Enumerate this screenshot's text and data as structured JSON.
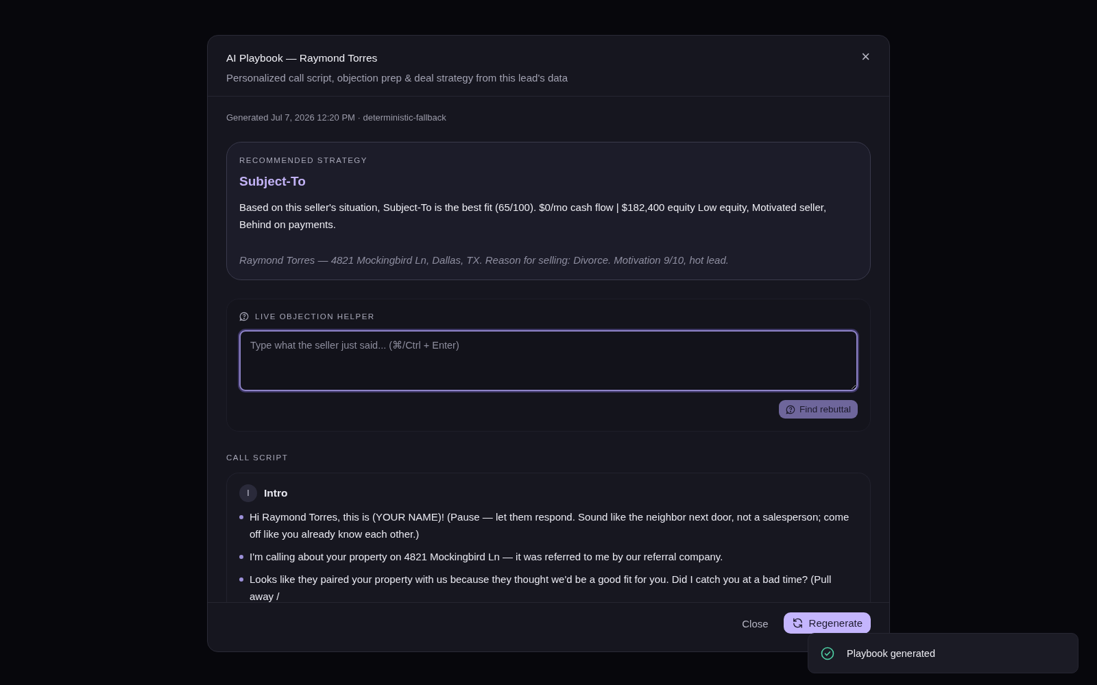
{
  "dialog": {
    "title": "AI Playbook — Raymond Torres",
    "subtitle": "Personalized call script, objection prep & deal strategy from this lead's data",
    "close_icon": "×"
  },
  "generated": "Generated Jul 7, 2026 12:20 PM · deterministic-fallback",
  "strategy": {
    "label": "RECOMMENDED STRATEGY",
    "name": "Subject-To",
    "summary": "Based on this seller's situation, Subject-To is the best fit (65/100). $0/mo cash flow | $182,400 equity Low equity, Motivated seller, Behind on payments.",
    "context": "Raymond Torres — 4821 Mockingbird Ln, Dallas, TX. Reason for selling: Divorce. Motivation 9/10, hot lead."
  },
  "objection_helper": {
    "label": "LIVE OBJECTION HELPER",
    "placeholder": "Type what the seller just said... (⌘/Ctrl + Enter)",
    "button": "Find rebuttal",
    "disabled": true
  },
  "call_script": {
    "label": "CALL SCRIPT",
    "sections": [
      {
        "badge": "I",
        "title": "Intro",
        "lines": [
          "Hi Raymond Torres, this is (YOUR NAME)! (Pause — let them respond. Sound like the neighbor next door, not a salesperson; come off like you already know each other.)",
          "I'm calling about your property on 4821 Mockingbird Ln — it was referred to me by our referral company.",
          "Looks like they paired your property with us because they thought we'd be a good fit for you. Did I catch you at a bad time? (Pull away /"
        ]
      }
    ]
  },
  "footer": {
    "buttons": [
      {
        "label": "Close",
        "kind": "ghost"
      },
      {
        "label": "Regenerate",
        "kind": "primary"
      }
    ]
  },
  "toast": {
    "message": "Playbook generated"
  }
}
